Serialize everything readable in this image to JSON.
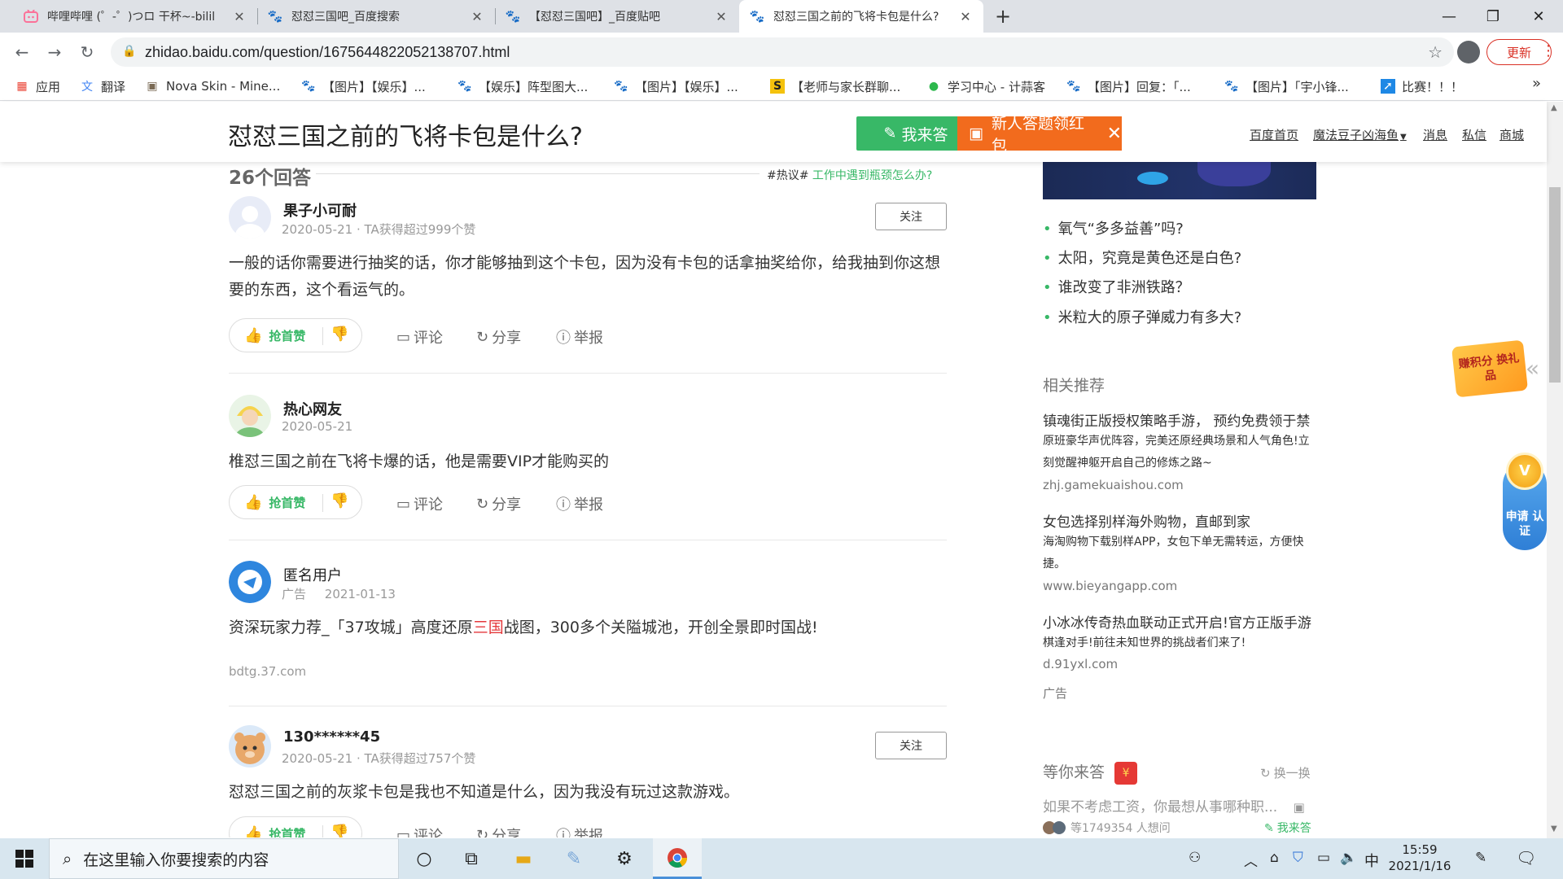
{
  "browser": {
    "tabs": [
      {
        "label": "哔哩哔哩 (゜-゜)つロ 干杯~-bilil",
        "icon": "bilibili-icon"
      },
      {
        "label": "怼怼三国吧_百度搜索",
        "icon": "baidu-paw-icon"
      },
      {
        "label": "【怼怼三国吧】_百度贴吧",
        "icon": "baidu-paw-icon"
      },
      {
        "label": "怼怼三国之前的飞将卡包是什么?",
        "icon": "baidu-paw-icon",
        "active": true
      }
    ],
    "new_tab": "+",
    "url": "zhidao.baidu.com/question/1675644822052138707.html",
    "update_label": "更新",
    "bookmarks": [
      {
        "label": "应用",
        "icon": "apps-grid-icon"
      },
      {
        "label": "翻译",
        "icon": "translate-icon"
      },
      {
        "label": "Nova Skin - Mine...",
        "icon": "nova-skin-icon"
      },
      {
        "label": "【图片】【娱乐】...",
        "icon": "baidu-paw-icon"
      },
      {
        "label": "【娱乐】阵型图大...",
        "icon": "baidu-paw-icon"
      },
      {
        "label": "【图片】【娱乐】...",
        "icon": "baidu-paw-icon"
      },
      {
        "label": "【老师与家长群聊...",
        "icon": "s-logo-icon"
      },
      {
        "label": "学习中心 - 计蒜客",
        "icon": "jisuanke-icon"
      },
      {
        "label": "【图片】回复：「...",
        "icon": "baidu-paw-icon"
      },
      {
        "label": "【图片】「宇小锋...",
        "icon": "baidu-paw-icon"
      },
      {
        "label": "比赛！！！",
        "icon": "bookmark-arrow-icon"
      }
    ],
    "bookmarks_more": "»"
  },
  "header": {
    "question_title": "怼怼三国之前的飞将卡包是什么?",
    "answer_button": "我来答",
    "redpack_button": "新人答题领红包",
    "links": [
      "百度首页",
      "魔法豆子凶海鱼",
      "消息",
      "私信",
      "商城"
    ]
  },
  "main": {
    "answer_count": "26个回答",
    "hot_tag": "#热议#",
    "hot_link": "工作中遇到瓶颈怎么办?",
    "answers": [
      {
        "user": "果子小可耐",
        "meta": "2020-05-21 · TA获得超过999个赞",
        "follow": "关注",
        "text": "一般的话你需要进行抽奖的话，你才能够抽到这个卡包，因为没有卡包的话拿抽奖给你，给我抽到你这想要的东西，这个看运气的。"
      },
      {
        "user": "热心网友",
        "meta": "2020-05-21",
        "text": "椎怼三国之前在飞将卡爆的话，他是需要VIP才能购买的"
      },
      {
        "user": "匿名用户",
        "ad_tag": "广告",
        "meta": "2021-01-13",
        "text_before": "资深玩家力荐_「37攻城」高度还原",
        "text_highlight": "三国",
        "text_after": "战图，300多个关隘城池，开创全景即时国战!",
        "ad_url": "bdtg.37.com"
      },
      {
        "user": "130******45",
        "meta": "2020-05-21 · TA获得超过757个赞",
        "follow": "关注",
        "text": "怼怼三国之前的灰浆卡包是我也不知道是什么，因为我没有玩过这款游戏。"
      }
    ],
    "actions": {
      "upvote": "抢首赞",
      "comment": "评论",
      "share": "分享",
      "report": "举报"
    }
  },
  "sidebar": {
    "hot_questions": [
      "氧气“多多益善”吗?",
      "太阳，究竟是黄色还是白色?",
      "谁改变了非洲铁路？",
      "米粒大的原子弹威力有多大?"
    ],
    "related_title": "相关推荐",
    "recommendations": [
      {
        "title": "镇魂街正版授权策略手游， 预约免费领于禁",
        "desc": "原班豪华声优阵容，完美还原经典场景和人气角色!立刻觉醒神躯开启自己的修炼之路~",
        "url": "zhj.gamekuaishou.com"
      },
      {
        "title": "女包选择别样海外购物，直邮到家",
        "desc": "海淘购物下载别样APP，女包下单无需转运，方便快捷。",
        "url": "www.bieyangapp.com"
      },
      {
        "title": "小冰冰传奇热血联动正式开启!官方正版手游",
        "desc": "棋逢对手!前往未知世界的挑战者们来了!",
        "url": "d.91yxl.com"
      }
    ],
    "ad_label": "广告",
    "waiting_title": "等你来答",
    "swap_label": "换一换",
    "waiting_question": "如果不考虑工资，你最想从事哪种职...",
    "waiting_meta": "等1749354 人想问",
    "waiting_answer": "我来答",
    "float_gift": "赚积分 换礼品",
    "float_cert": "申请 认证",
    "float_cert_medal": "V"
  },
  "taskbar": {
    "search_placeholder": "在这里输入你要搜索的内容",
    "ime": "中",
    "time": "15:59",
    "date": "2021/1/16"
  },
  "colors": {
    "baidu_green": "#38b867",
    "redpack_orange": "#f26b1d",
    "highlight_red": "#e4393c"
  }
}
